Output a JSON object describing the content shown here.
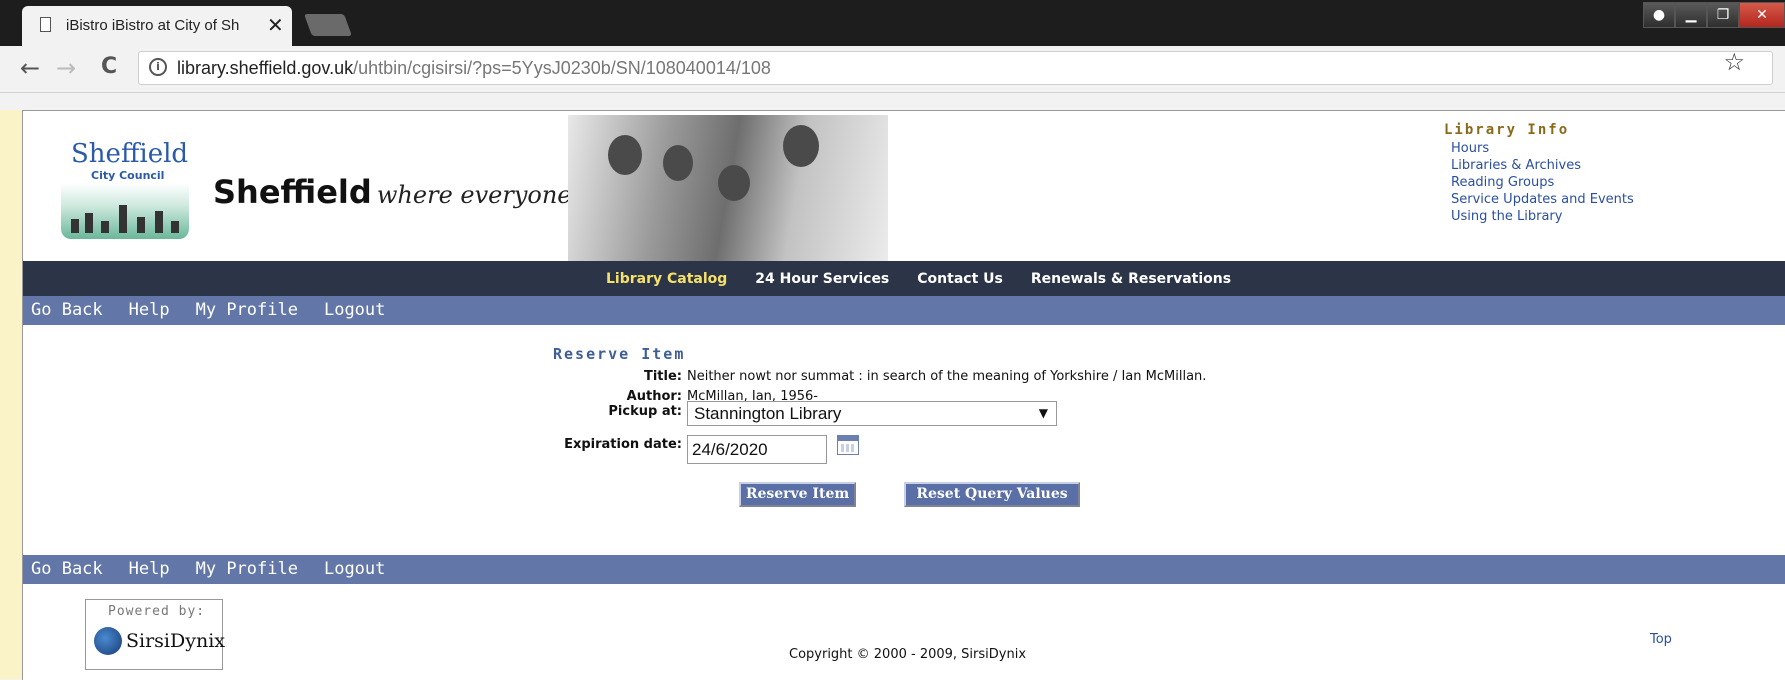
{
  "browser": {
    "tab_title": "iBistro iBistro at City of Sh",
    "close_glyph": "✕",
    "url_host": "library.sheffield.gov.uk",
    "url_path": "/uhtbin/cgisirsi/?ps=5YysJ0230b/SN/108040014/108",
    "back_glyph": "←",
    "forward_glyph": "→",
    "reload_glyph": "C",
    "star_glyph": "☆",
    "info_glyph": "i"
  },
  "header": {
    "logo_line1": "Sheffield",
    "logo_line2": "City Council",
    "brand": "Sheffield",
    "motto": "where everyone matters"
  },
  "library_info": {
    "title": "Library Info",
    "links": [
      "Hours",
      "Libraries & Archives",
      "Reading Groups",
      "Service Updates and Events",
      "Using the Library"
    ]
  },
  "main_nav": {
    "items": [
      "Library Catalog",
      "24 Hour Services",
      "Contact Us",
      "Renewals & Reservations"
    ]
  },
  "link_bar": {
    "items": [
      "Go Back",
      "Help",
      "My Profile",
      "Logout"
    ]
  },
  "reserve": {
    "heading": "Reserve Item",
    "title_label": "Title:",
    "title_value": "Neither nowt nor summat : in search of the meaning of Yorkshire / Ian McMillan.",
    "author_label": "Author:",
    "author_value": "McMillan, Ian, 1956-",
    "pickup_label": "Pickup at:",
    "pickup_value": "Stannington Library",
    "expiration_label": "Expiration date:",
    "expiration_value": "24/6/2020",
    "reserve_button": "Reserve Item",
    "reset_button": "Reset Query Values"
  },
  "footer": {
    "powered_by": "Powered by:",
    "vendor": "SirsiDynix",
    "copyright": "Copyright © 2000 - 2009, SirsiDynix",
    "top_link": "Top"
  }
}
